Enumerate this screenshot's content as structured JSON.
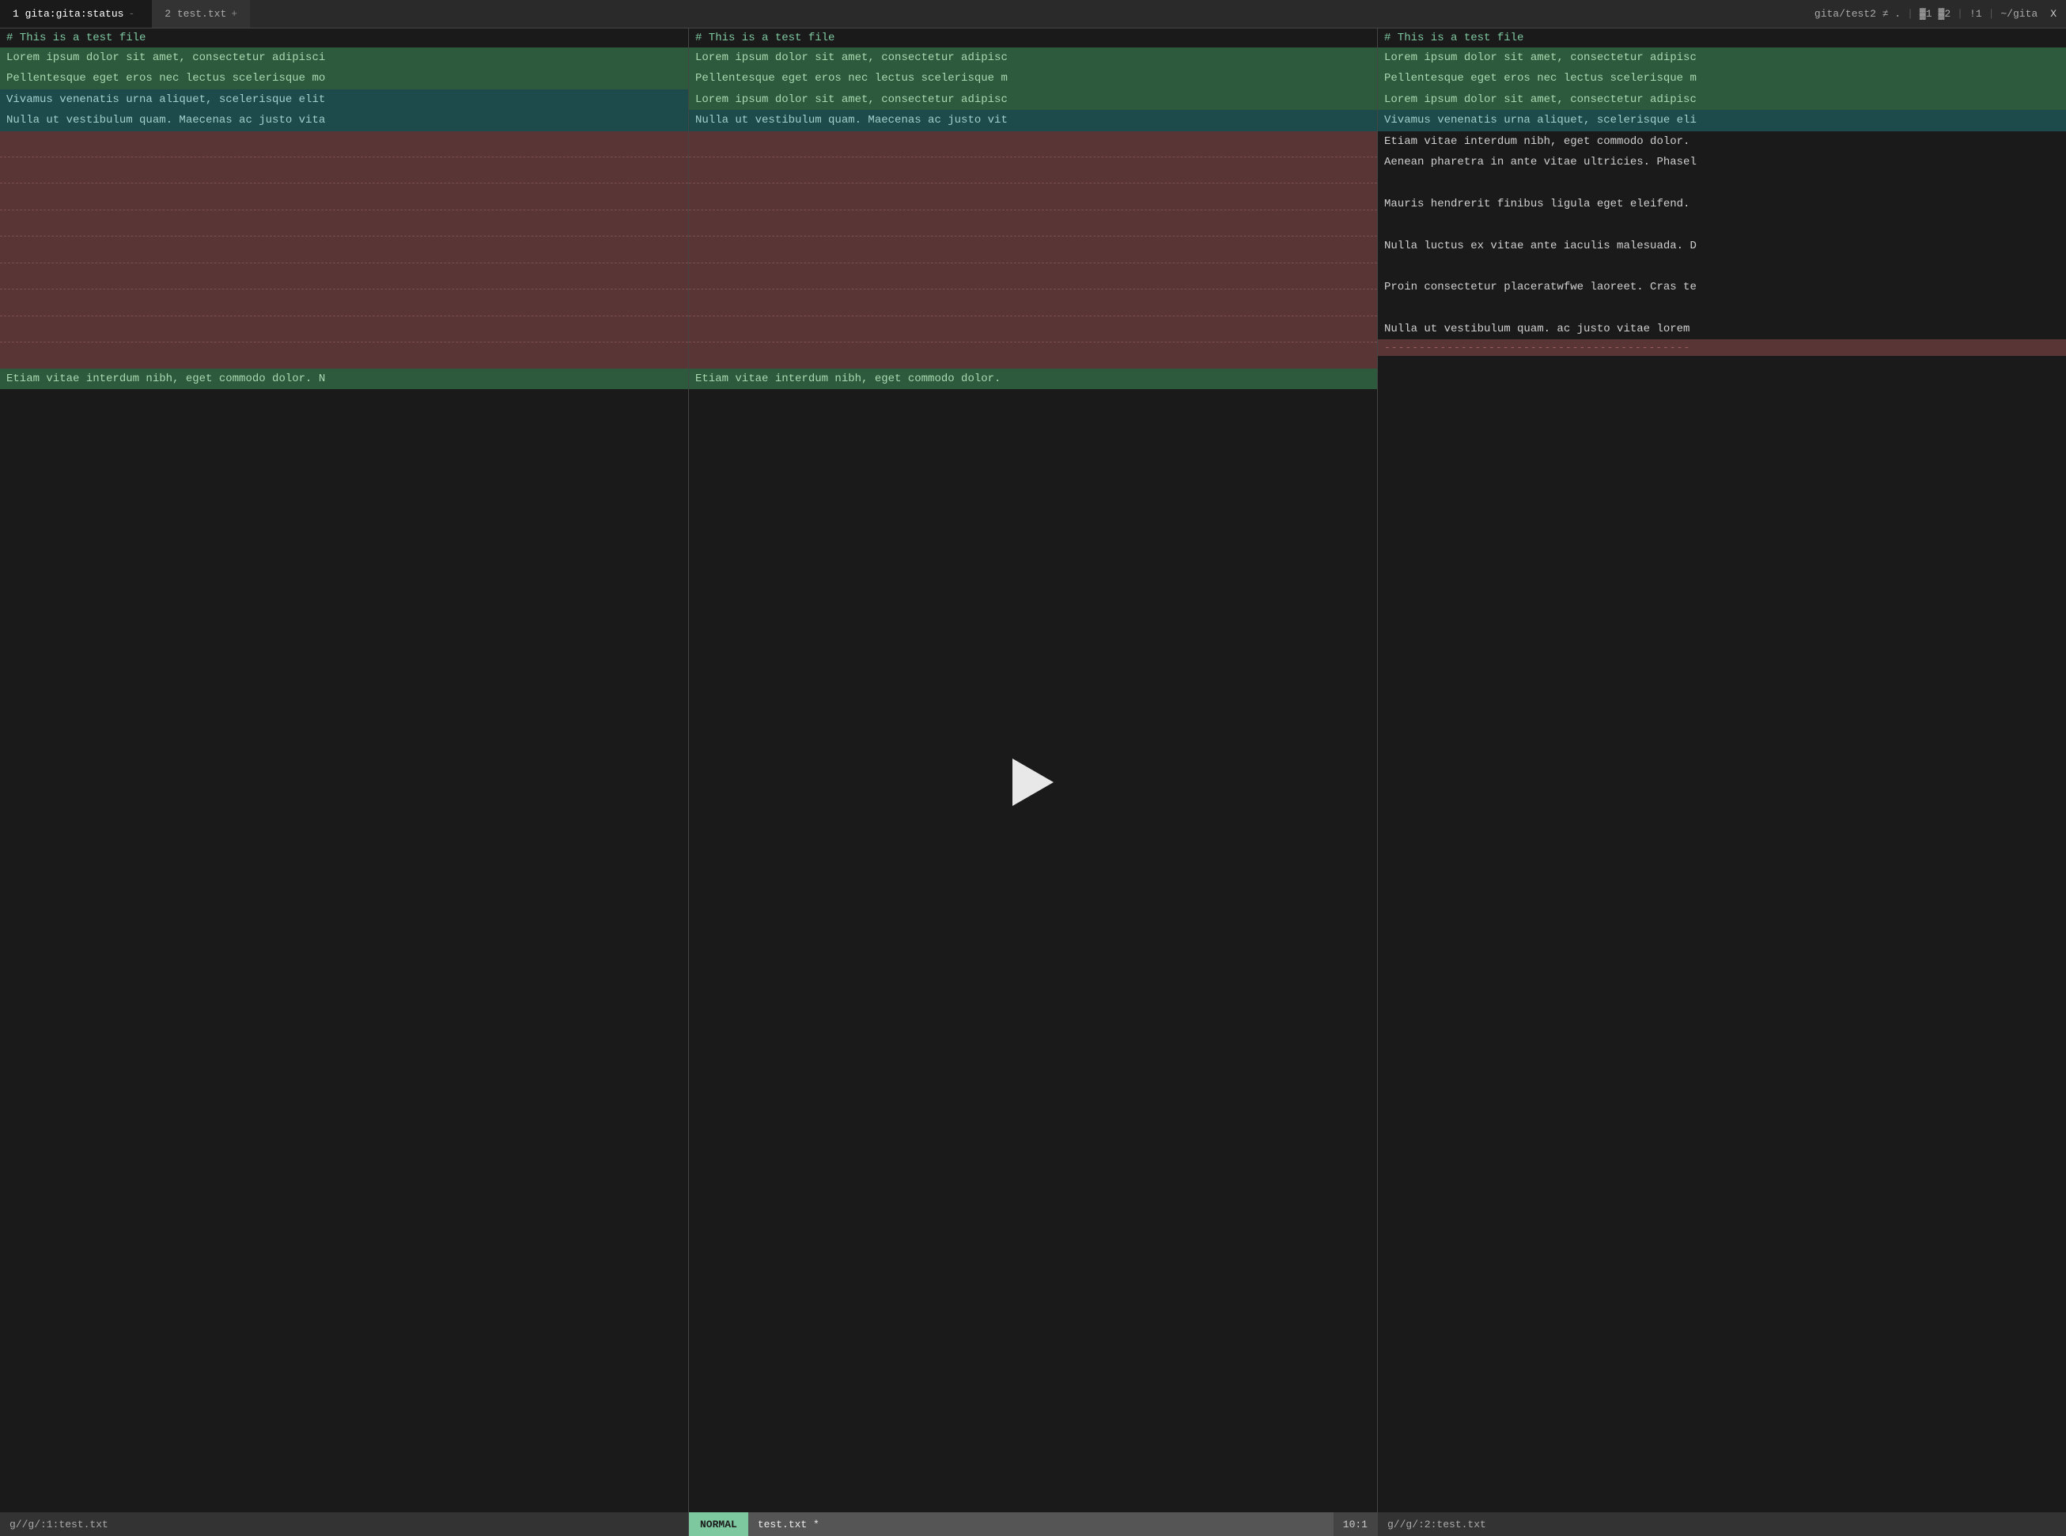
{
  "tabbar": {
    "tab1_label": "1 gita:gita:status",
    "tab1_sep": "-",
    "tab2_label": "2 test.txt",
    "tab2_plus": "+",
    "right_info": "gita/test2 ≠ .",
    "right_buf1": "▓1",
    "right_buf2": "▓2",
    "right_mark": "!1",
    "right_path": "~/gita",
    "right_close": "X"
  },
  "pane_left": {
    "header": "# This is a test file",
    "lines": [
      {
        "text": "Lorem ipsum dolor sit amet, consectetur adipisci",
        "type": "highlight-green"
      },
      {
        "text": "Pellentesque eget eros nec lectus scelerisque mo",
        "type": "highlight-green"
      },
      {
        "text": "Vivamus venenatis urna aliquet, scelerisque elit",
        "type": "highlight-teal"
      },
      {
        "text": "Nulla ut vestibulum quam. Maecenas ac justo vita",
        "type": "highlight-teal"
      }
    ],
    "dashed_count": 9,
    "bottom_line": {
      "text": "Etiam vitae interdum nibh, eget commodo dolor. N",
      "type": "highlight-green"
    },
    "statusbar": "g//g/:1:test.txt"
  },
  "pane_middle": {
    "header": "# This is a test file",
    "lines": [
      {
        "text": "Lorem ipsum dolor sit amet, consectetur adipisc",
        "type": "highlight-green"
      },
      {
        "text": "Pellentesque eget eros nec lectus scelerisque m",
        "type": "highlight-green"
      },
      {
        "text": "Lorem ipsum dolor sit amet, consectetur adipisc",
        "type": "highlight-green"
      },
      {
        "text": "Nulla ut vestibulum quam. Maecenas ac justo vit",
        "type": "highlight-teal"
      }
    ],
    "dashed_count": 9,
    "bottom_line": {
      "text": "Etiam vitae interdum nibh, eget commodo dolor.",
      "type": "highlight-green"
    },
    "status_mode": "NORMAL",
    "status_file": "test.txt *",
    "status_pos": "10:1"
  },
  "pane_right": {
    "header": "# This is a test file",
    "lines": [
      {
        "text": "Lorem ipsum dolor sit amet, consectetur adipisc",
        "type": "highlight-green"
      },
      {
        "text": "Pellentesque eget eros nec lectus scelerisque m",
        "type": "highlight-green"
      },
      {
        "text": "Lorem ipsum dolor sit amet, consectetur adipisc",
        "type": "highlight-green"
      },
      {
        "text": "Vivamus venenatis urna aliquet, scelerisque eli",
        "type": "highlight-teal"
      },
      {
        "text": "Etiam vitae interdum nibh, eget commodo dolor.",
        "type": "normal"
      },
      {
        "text": "Aenean pharetra in ante vitae ultricies. Phasel",
        "type": "normal"
      },
      {
        "text": "",
        "type": "normal"
      },
      {
        "text": "Mauris hendrerit finibus ligula eget eleifend.",
        "type": "normal"
      },
      {
        "text": "",
        "type": "normal"
      },
      {
        "text": "Nulla luctus ex vitae ante iaculis malesuada. D",
        "type": "normal"
      },
      {
        "text": "",
        "type": "normal"
      },
      {
        "text": "Proin consectetur placeratwfwe laoreet. Cras te",
        "type": "normal"
      },
      {
        "text": "",
        "type": "normal"
      },
      {
        "text": "Nulla ut vestibulum quam. ac justo vitae lorem",
        "type": "normal"
      }
    ],
    "dashed_marker": "--------------------------------------------",
    "statusbar": "g//g/:2:test.txt"
  },
  "dashed_line": "- - - - - - - - - - - - - - - - - - - - - - - - - - - - - - - - - - - - - - - - - - - - - - - -",
  "icons": {
    "play": "▶"
  }
}
